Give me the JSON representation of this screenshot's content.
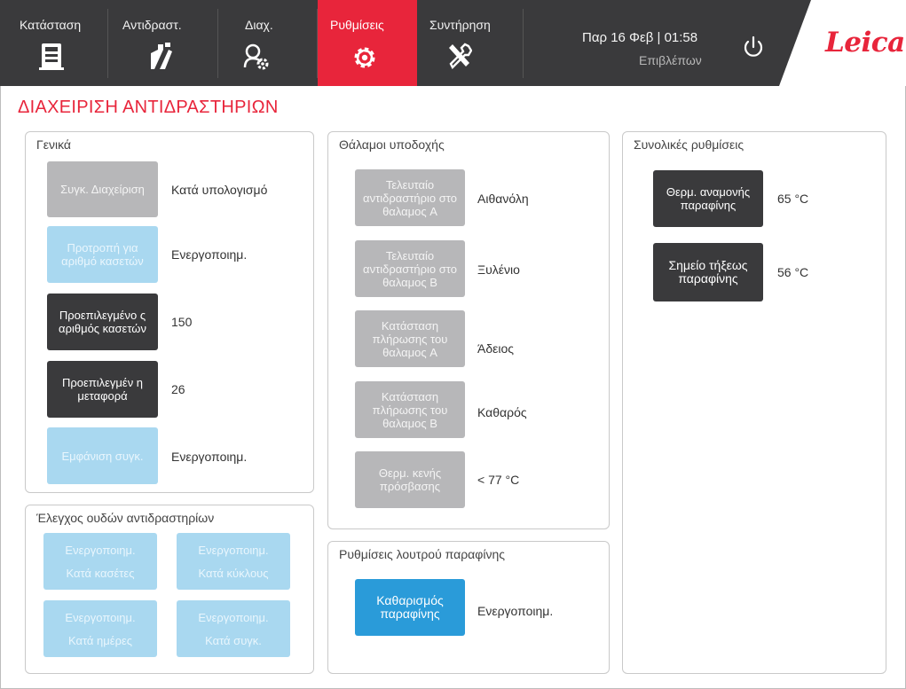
{
  "nav": {
    "items": [
      {
        "label": "Κατάσταση",
        "icon": "instrument-status-icon"
      },
      {
        "label": "Αντιδραστ.",
        "icon": "reagents-bottle-icon"
      },
      {
        "label": "Διαχ.",
        "icon": "admin-users-gear-icon"
      },
      {
        "label": "Ρυθμίσεις",
        "icon": "settings-gear-icon"
      },
      {
        "label": "Συντήρηση",
        "icon": "maintenance-tools-icon"
      }
    ],
    "active": "Ρυθμίσεις"
  },
  "status": {
    "datetime": "Παρ 16 Φεβ | 01:58",
    "user": "Επιβλέπων"
  },
  "brand": {
    "logo": "Leica"
  },
  "page": {
    "title": "ΔΙΑΧΕΙΡΙΣΗ ΑΝΤΙΔΡΑΣΤΗΡΙΩΝ"
  },
  "general": {
    "title": "Γενικά",
    "rows": [
      {
        "button": "Συγκ. Διαχείριση",
        "value": "Κατά υπολογισμό"
      },
      {
        "button": "Προτροπή για αριθμό κασετών",
        "value": "Ενεργοποιημ."
      },
      {
        "button": "Προεπιλεγμένο ς αριθμός κασετών",
        "value": "150"
      },
      {
        "button": "Προεπιλεγμέν η μεταφορά",
        "value": "26"
      },
      {
        "button": "Εμφάνιση συγκ.",
        "value": "Ενεργοποιημ."
      }
    ]
  },
  "checks": {
    "title": "Έλεγχος ουδών αντιδραστηρίων",
    "buttons": [
      {
        "line1": "Ενεργοποιημ.",
        "line2": "Κατά κασέτες"
      },
      {
        "line1": "Ενεργοποιημ.",
        "line2": "Κατά κύκλους"
      },
      {
        "line1": "Ενεργοποιημ.",
        "line2": "Κατά ημέρες"
      },
      {
        "line1": "Ενεργοποιημ.",
        "line2": "Κατά συγκ."
      }
    ]
  },
  "chambers": {
    "title": "Θάλαμοι υποδοχής",
    "rows": [
      {
        "button": "Τελευταίο αντιδραστήριο στο θαλαμος A",
        "value": "Αιθανόλη"
      },
      {
        "button": "Τελευταίο αντιδραστήριο στο θαλαμος B",
        "value": "Ξυλένιο"
      },
      {
        "button": "Κατάσταση πλήρωσης του θαλαμος A",
        "value": "Άδειος"
      },
      {
        "button": "Κατάσταση πλήρωσης του θαλαμος B",
        "value": "Καθαρός"
      },
      {
        "button": "Θερμ. κενής πρόσβασης",
        "value": "< 77 °C"
      }
    ]
  },
  "paraffin_bath": {
    "title": "Ρυθμίσεις λουτρού παραφίνης",
    "button": "Καθαρισμός παραφίνης",
    "value": "Ενεργοποιημ."
  },
  "global": {
    "title": "Συνολικές ρυθμίσεις",
    "rows": [
      {
        "button": "Θερμ. αναμονής παραφίνης",
        "value": "65 °C"
      },
      {
        "button": "Σημείο τήξεως παραφίνης",
        "value": "56 °C"
      }
    ]
  },
  "colors": {
    "header_bg": "#3a3a3c",
    "accent_red": "#e8253b",
    "button_gray": "#b7b7b9",
    "button_light_blue": "#a9d8f0",
    "button_dark": "#3a3a3c",
    "button_blue": "#2a9bd9"
  }
}
